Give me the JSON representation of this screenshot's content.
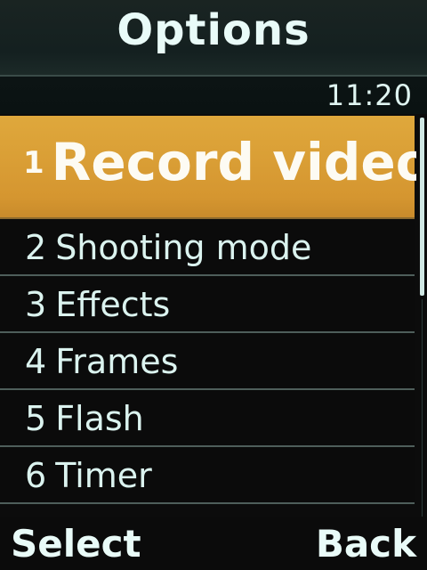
{
  "title": "Options",
  "clock": "11:20",
  "menu": {
    "items": [
      {
        "number": "1",
        "label": "Record video",
        "selected": true
      },
      {
        "number": "2",
        "label": "Shooting mode"
      },
      {
        "number": "3",
        "label": "Effects"
      },
      {
        "number": "4",
        "label": "Frames"
      },
      {
        "number": "5",
        "label": "Flash"
      },
      {
        "number": "6",
        "label": "Timer"
      }
    ]
  },
  "softkeys": {
    "left": "Select",
    "right": "Back"
  },
  "colors": {
    "highlight": "#d79c32",
    "text": "#dbf3ef",
    "background": "#0b0b0b"
  }
}
